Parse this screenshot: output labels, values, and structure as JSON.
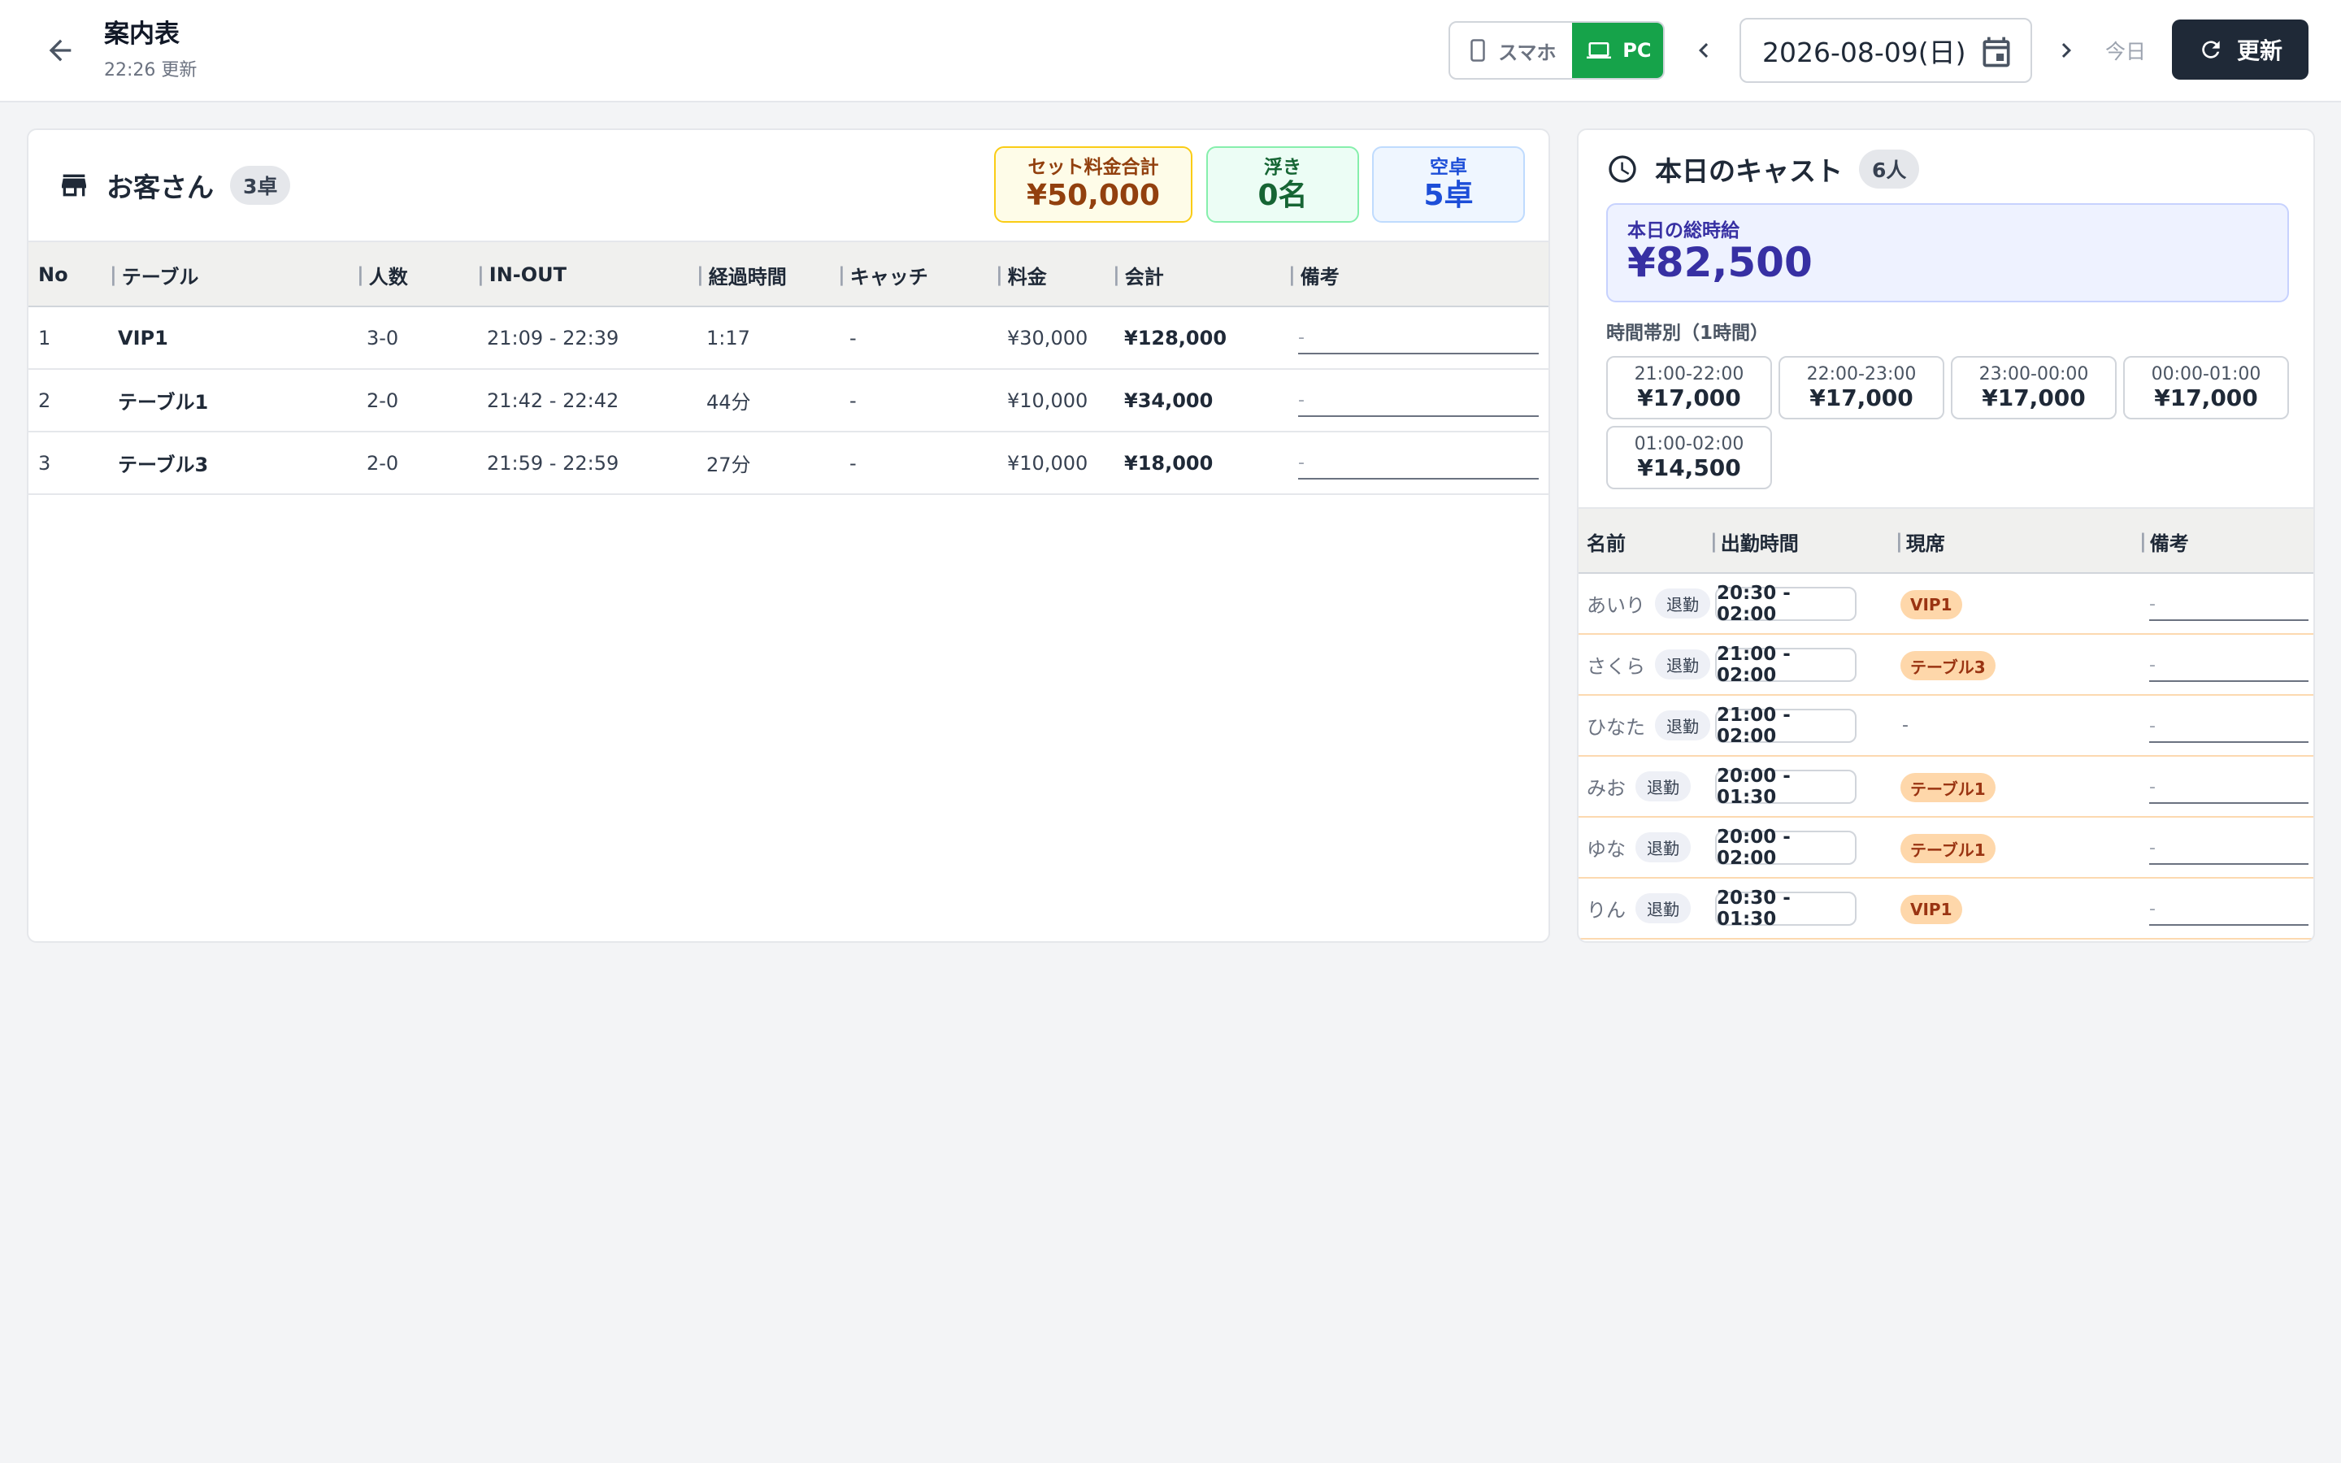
{
  "header": {
    "title": "案内表",
    "updated": "22:26 更新",
    "device": {
      "sp_label": "スマホ",
      "pc_label": "PC",
      "selected": "PC"
    },
    "date": "2026-08-09(日)",
    "today_label": "今日",
    "refresh_label": "更新"
  },
  "customers": {
    "title": "お客さん",
    "count_badge": "3卓",
    "stats": {
      "set_total": {
        "label": "セット料金合計",
        "value": "¥50,000"
      },
      "floating": {
        "label": "浮き",
        "value": "0名"
      },
      "empty": {
        "label": "空卓",
        "value": "5卓"
      }
    },
    "columns": [
      "No",
      "テーブル",
      "人数",
      "IN-OUT",
      "経過時間",
      "キャッチ",
      "料金",
      "会計",
      "備考"
    ],
    "rows": [
      {
        "no": "1",
        "table": "VIP1",
        "people": "3-0",
        "in_out": "21:09 - 22:39",
        "elapsed": "1:17",
        "catch": "-",
        "fee": "¥30,000",
        "total": "¥128,000",
        "note": "-"
      },
      {
        "no": "2",
        "table": "テーブル1",
        "people": "2-0",
        "in_out": "21:42 - 22:42",
        "elapsed": "44分",
        "catch": "-",
        "fee": "¥10,000",
        "total": "¥34,000",
        "note": "-"
      },
      {
        "no": "3",
        "table": "テーブル3",
        "people": "2-0",
        "in_out": "21:59 - 22:59",
        "elapsed": "27分",
        "catch": "-",
        "fee": "¥10,000",
        "total": "¥18,000",
        "note": "-"
      }
    ]
  },
  "cast": {
    "title": "本日のキャスト",
    "count_badge": "6人",
    "total_wage": {
      "label": "本日の総時給",
      "value": "¥82,500"
    },
    "hourly_label": "時間帯別（1時間）",
    "slots": [
      {
        "time": "21:00-22:00",
        "value": "¥17,000"
      },
      {
        "time": "22:00-23:00",
        "value": "¥17,000"
      },
      {
        "time": "23:00-00:00",
        "value": "¥17,000"
      },
      {
        "time": "00:00-01:00",
        "value": "¥17,000"
      },
      {
        "time": "01:00-02:00",
        "value": "¥14,500"
      }
    ],
    "columns": [
      "名前",
      "出勤時間",
      "現席",
      "備考"
    ],
    "members": [
      {
        "name": "あいり",
        "status": "退勤",
        "time": "20:30 - 02:00",
        "seat": "VIP1",
        "note": "-"
      },
      {
        "name": "さくら",
        "status": "退勤",
        "time": "21:00 - 02:00",
        "seat": "テーブル3",
        "note": "-"
      },
      {
        "name": "ひなた",
        "status": "退勤",
        "time": "21:00 - 02:00",
        "seat": "-",
        "note": "-"
      },
      {
        "name": "みお",
        "status": "退勤",
        "time": "20:00 - 01:30",
        "seat": "テーブル1",
        "note": "-"
      },
      {
        "name": "ゆな",
        "status": "退勤",
        "time": "20:00 - 02:00",
        "seat": "テーブル1",
        "note": "-"
      },
      {
        "name": "りん",
        "status": "退勤",
        "time": "20:30 - 01:30",
        "seat": "VIP1",
        "note": "-"
      }
    ]
  }
}
